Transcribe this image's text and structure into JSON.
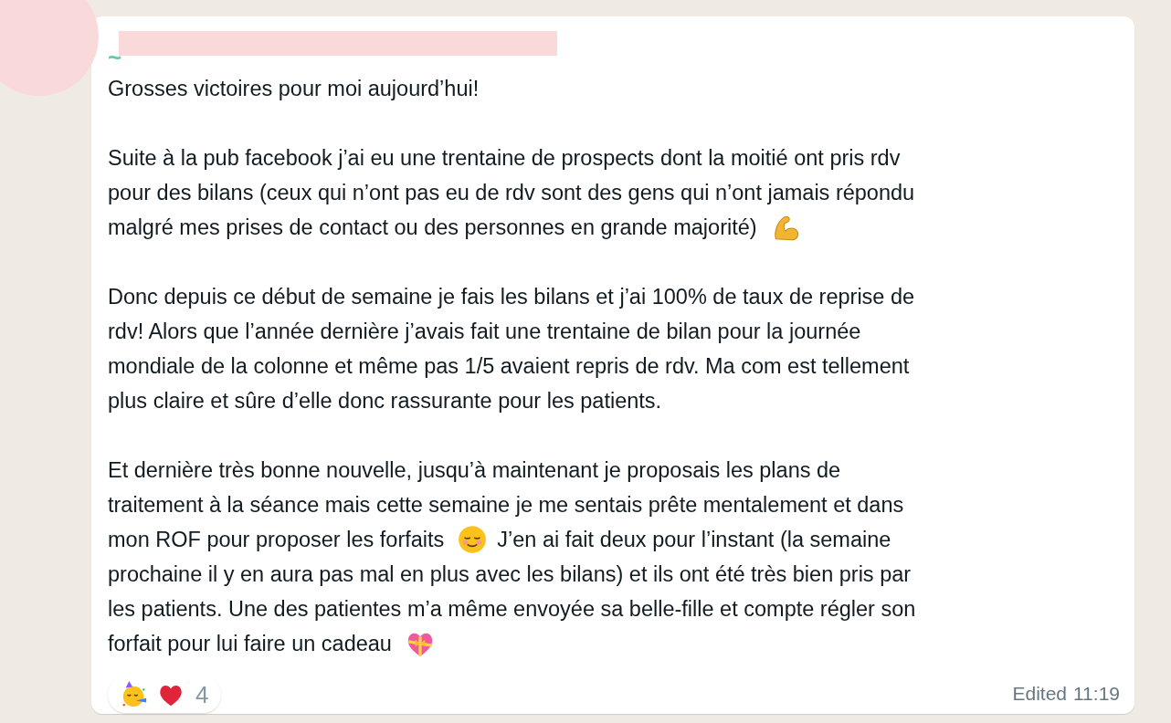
{
  "message": {
    "sender": "~",
    "paragraphs": [
      [
        [
          {
            "kind": "text",
            "text": "Grosses victoires pour moi aujourd’hui!"
          }
        ]
      ],
      [
        [
          {
            "kind": "text",
            "text": "Suite à la pub facebook j’ai eu une trentaine de prospects dont la moitié ont pris rdv"
          }
        ],
        [
          {
            "kind": "text",
            "text": "pour des bilans (ceux qui n’ont pas eu de rdv sont des gens qui n’ont jamais répondu"
          }
        ],
        [
          {
            "kind": "text",
            "text": "malgré mes prises de contact ou des personnes en grande majorité)"
          },
          {
            "kind": "muscle"
          }
        ]
      ],
      [
        [
          {
            "kind": "text",
            "text": "Donc depuis ce début de semaine je fais les bilans et j’ai 100% de taux de reprise de"
          }
        ],
        [
          {
            "kind": "text",
            "text": "rdv! Alors que l’année dernière j’avais fait une trentaine de bilan pour la journée"
          }
        ],
        [
          {
            "kind": "text",
            "text": "mondiale de la colonne et même pas 1/5 avaient repris de rdv. Ma com est tellement"
          }
        ],
        [
          {
            "kind": "text",
            "text": "plus claire et sûre d’elle donc rassurante pour les patients."
          }
        ]
      ],
      [
        [
          {
            "kind": "text",
            "text": "Et dernière très bonne nouvelle, jusqu’à maintenant je proposais les plans de"
          }
        ],
        [
          {
            "kind": "text",
            "text": "traitement à la séance mais cette semaine je me sentais prête mentalement et dans"
          }
        ],
        [
          {
            "kind": "text",
            "text": "mon ROF pour proposer les forfaits"
          },
          {
            "kind": "relieved"
          },
          {
            "kind": "text",
            "text": "J’en ai fait deux pour l’instant (la semaine"
          }
        ],
        [
          {
            "kind": "text",
            "text": "prochaine il y en aura pas mal en plus avec les bilans) et ils ont été très bien pris par"
          }
        ],
        [
          {
            "kind": "text",
            "text": "les patients. Une des patientes m’a même envoyée sa belle-fille et compte régler son"
          }
        ],
        [
          {
            "kind": "text",
            "text": "forfait pour lui faire un cadeau"
          },
          {
            "kind": "gift-heart"
          }
        ]
      ]
    ],
    "edited": "Edited",
    "time": "11:19",
    "reactions": [
      {
        "kind": "party"
      },
      {
        "kind": "heart"
      }
    ],
    "reaction_count": "4"
  }
}
